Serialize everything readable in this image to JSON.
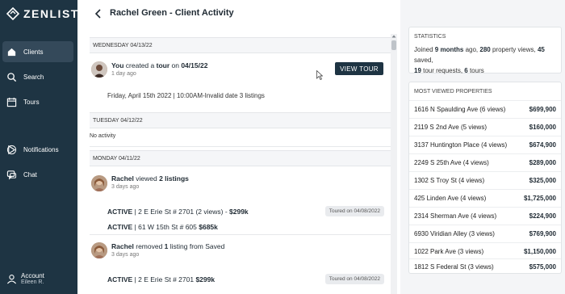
{
  "brand": {
    "name": "ZENLIST"
  },
  "sidebar": {
    "items": [
      {
        "label": "Clients",
        "icon": "home-icon",
        "active": true
      },
      {
        "label": "Search",
        "icon": "search-icon"
      },
      {
        "label": "Tours",
        "icon": "calendar-icon"
      },
      {
        "label": "Notifications",
        "icon": "bell-icon"
      },
      {
        "label": "Chat",
        "icon": "chat-icon"
      }
    ],
    "account": {
      "label": "Account",
      "name": "Eileen R."
    }
  },
  "header": {
    "title": "Rachel Green - Client Activity"
  },
  "feed": {
    "days": [
      {
        "date": "WEDNESDAY 04/13/22"
      },
      {
        "date": "TUESDAY 04/12/22"
      },
      {
        "date": "MONDAY 04/11/22"
      }
    ],
    "tour_activity": {
      "actor": "You",
      "verb": " created a ",
      "object": "tour",
      "mid": " on ",
      "date": "04/15/22",
      "ago": "1 day ago",
      "detail": "Friday, April 15th 2022 | 10:00AM-Invalid date 3 listings",
      "button": "VIEW TOUR"
    },
    "no_activity": "No activity",
    "viewed_activity": {
      "actor": "Rachel",
      "verb": " viewed ",
      "object": "2 listings",
      "ago": "3 days ago",
      "listings": [
        {
          "status": "ACTIVE",
          "addr": " | 2 E Erie St # 2701 (2 views) - ",
          "price": "$299k",
          "toured": "Toured on 04/08/2022"
        },
        {
          "status": "ACTIVE",
          "addr": " | 61 W 15th St # 605 ",
          "price": "$685k",
          "toured": ""
        }
      ]
    },
    "removed_activity": {
      "actor": "Rachel",
      "verb": " removed ",
      "object": "1",
      "rest": " listing from Saved",
      "ago": "3 days ago",
      "listings": [
        {
          "status": "ACTIVE",
          "addr": " | 2 E Erie St # 2701 ",
          "price": "$299k",
          "toured": "Toured on 04/08/2022"
        }
      ]
    }
  },
  "statistics": {
    "title": "STATISTICS",
    "joined_pre": "Joined ",
    "joined_val": "9 months",
    "joined_post": " ago, ",
    "views_val": "280",
    "views_post": " property views, ",
    "saved_val": "45",
    "saved_post": " saved,",
    "requests_val": "19",
    "requests_post": " tour requests, ",
    "tours_val": "6",
    "tours_post": " tours"
  },
  "most_viewed": {
    "title": "MOST VIEWED PROPERTIES",
    "rows": [
      {
        "addr": "1616 N Spaulding Ave (6 views)",
        "price": "$699,900"
      },
      {
        "addr": "2119 S 2nd Ave (5 views)",
        "price": "$160,000"
      },
      {
        "addr": "3137 Huntington Place (4 views)",
        "price": "$674,900"
      },
      {
        "addr": "2249 S 25th Ave (4 views)",
        "price": "$289,000"
      },
      {
        "addr": "1302 S Troy St (4 views)",
        "price": "$325,000"
      },
      {
        "addr": "425 Linden Ave (4 views)",
        "price": "$1,725,000"
      },
      {
        "addr": "2314 Sherman Ave (4 views)",
        "price": "$224,900"
      },
      {
        "addr": "6930 Viridian Alley (3 views)",
        "price": "$769,900"
      },
      {
        "addr": "1022 Park Ave (3 views)",
        "price": "$1,150,000"
      },
      {
        "addr": "1812 S Federal St (3 views)",
        "price": "$575,000"
      }
    ]
  },
  "colors": {
    "sidebar": "#1e3443",
    "accent": "#1e3443"
  }
}
